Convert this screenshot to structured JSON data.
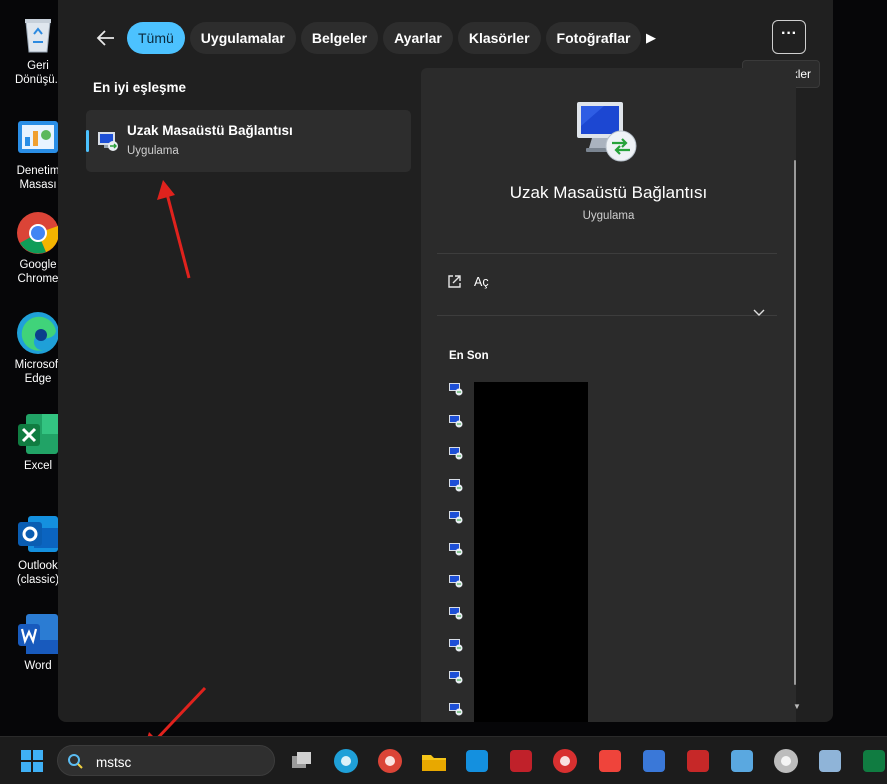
{
  "desktop": {
    "icons": [
      {
        "label": "Geri\nDönüşü..",
        "icon": "recycle-bin-icon"
      },
      {
        "label": "Denetim\nMasası",
        "icon": "control-panel-icon"
      },
      {
        "label": "Google\nChrome",
        "icon": "chrome-icon"
      },
      {
        "label": "Microsoft\nEdge",
        "icon": "edge-icon"
      },
      {
        "label": "Excel",
        "icon": "excel-icon"
      },
      {
        "label": "Outlook\n(classic)",
        "icon": "outlook-icon"
      },
      {
        "label": "Word",
        "icon": "word-icon"
      }
    ]
  },
  "search_panel": {
    "back_icon": "arrow-left-icon",
    "tabs": [
      {
        "label": "Tümü",
        "active": true
      },
      {
        "label": "Uygulamalar",
        "active": false
      },
      {
        "label": "Belgeler",
        "active": false
      },
      {
        "label": "Ayarlar",
        "active": false
      },
      {
        "label": "Klasörler",
        "active": false
      },
      {
        "label": "Fotoğraflar",
        "active": false
      }
    ],
    "more_tabs_icon": "play-icon",
    "options_label": "···",
    "options_tooltip": "Seçenekler",
    "best_match_title": "En iyi eşleşme",
    "best_match": {
      "name": "Uzak Masaüstü Bağlantısı",
      "type": "Uygulama",
      "icon": "remote-desktop-icon"
    },
    "details": {
      "name": "Uzak Masaüstü Bağlantısı",
      "type": "Uygulama",
      "open_label": "Aç",
      "open_icon": "open-external-icon",
      "expand_icon": "chevron-down-icon",
      "recent_title": "En Son",
      "recent_count": 11
    }
  },
  "taskbar": {
    "search_value": "mstsc",
    "search_icon": "search-icon",
    "apps": [
      "task-view-icon",
      "edge-icon",
      "chrome-icon",
      "file-explorer-icon",
      "outlook-icon",
      "app-red-icon",
      "app-red-circle-icon",
      "anydesk-icon",
      "network-icon",
      "filezilla-icon",
      "remote-tool-icon",
      "speedometer-icon",
      "server-icon",
      "excel-icon"
    ]
  },
  "colors": {
    "accent": "#4cc2ff",
    "panel": "#202020",
    "pane": "#2b2b2b",
    "annotation": "#e0221d"
  }
}
